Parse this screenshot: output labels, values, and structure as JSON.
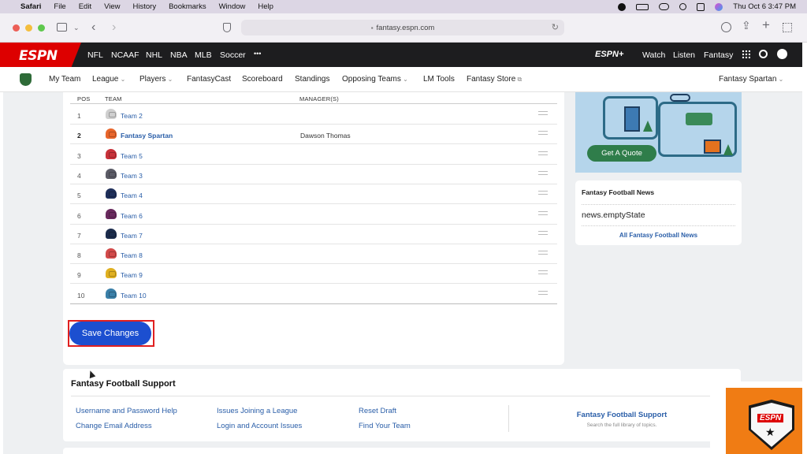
{
  "menubar": {
    "apple": "",
    "app_name": "Safari",
    "menus": [
      "File",
      "Edit",
      "View",
      "History",
      "Bookmarks",
      "Window",
      "Help"
    ],
    "datetime": "Thu Oct 6  3:47 PM"
  },
  "browser": {
    "url": "fantasy.espn.com"
  },
  "espn_nav": {
    "logo": "ESPN",
    "sports": [
      "NFL",
      "NCAAF",
      "NHL",
      "NBA",
      "MLB",
      "Soccer",
      "•••"
    ],
    "espn_plus": "ESPN+",
    "right_links": [
      "Watch",
      "Listen",
      "Fantasy"
    ]
  },
  "subnav": {
    "items": [
      "My Team",
      "League",
      "Players",
      "FantasyCast",
      "Scoreboard",
      "Standings",
      "Opposing Teams",
      "LM Tools",
      "Fantasy Store"
    ],
    "team_selector": "Fantasy Spartan"
  },
  "draft_order": {
    "headers": {
      "pos": "POS",
      "team": "TEAM",
      "manager": "MANAGER(S)"
    },
    "rows": [
      {
        "pos": "1",
        "team": "Team 2",
        "manager": "",
        "color": "#cfcfcf"
      },
      {
        "pos": "2",
        "team": "Fantasy Spartan",
        "manager": "Dawson Thomas",
        "color": "#e8652b"
      },
      {
        "pos": "3",
        "team": "Team 5",
        "manager": "",
        "color": "#c8323a"
      },
      {
        "pos": "4",
        "team": "Team 3",
        "manager": "",
        "color": "#5b5b66"
      },
      {
        "pos": "5",
        "team": "Team 4",
        "manager": "",
        "color": "#1f2f5a"
      },
      {
        "pos": "6",
        "team": "Team 6",
        "manager": "",
        "color": "#6a2a5e"
      },
      {
        "pos": "7",
        "team": "Team 7",
        "manager": "",
        "color": "#1c2c4c"
      },
      {
        "pos": "8",
        "team": "Team 8",
        "manager": "",
        "color": "#d24a4a"
      },
      {
        "pos": "9",
        "team": "Team 9",
        "manager": "",
        "color": "#e0b020"
      },
      {
        "pos": "10",
        "team": "Team 10",
        "manager": "",
        "color": "#3a7fa8"
      }
    ],
    "save_label": "Save Changes"
  },
  "ad": {
    "button": "Get A Quote"
  },
  "news": {
    "title": "Fantasy Football News",
    "empty": "news.emptyState",
    "link": "All Fantasy Football News"
  },
  "support": {
    "title": "Fantasy Football Support",
    "col1": [
      "Username and Password Help",
      "Change Email Address"
    ],
    "col2": [
      "Issues Joining a League",
      "Login and Account Issues"
    ],
    "col3": [
      "Reset Draft",
      "Find Your Team"
    ],
    "promo_title": "Fantasy Football Support",
    "promo_sub": "Search the full library of topics."
  },
  "badge": {
    "logo": "ESPN",
    "star": "★"
  }
}
